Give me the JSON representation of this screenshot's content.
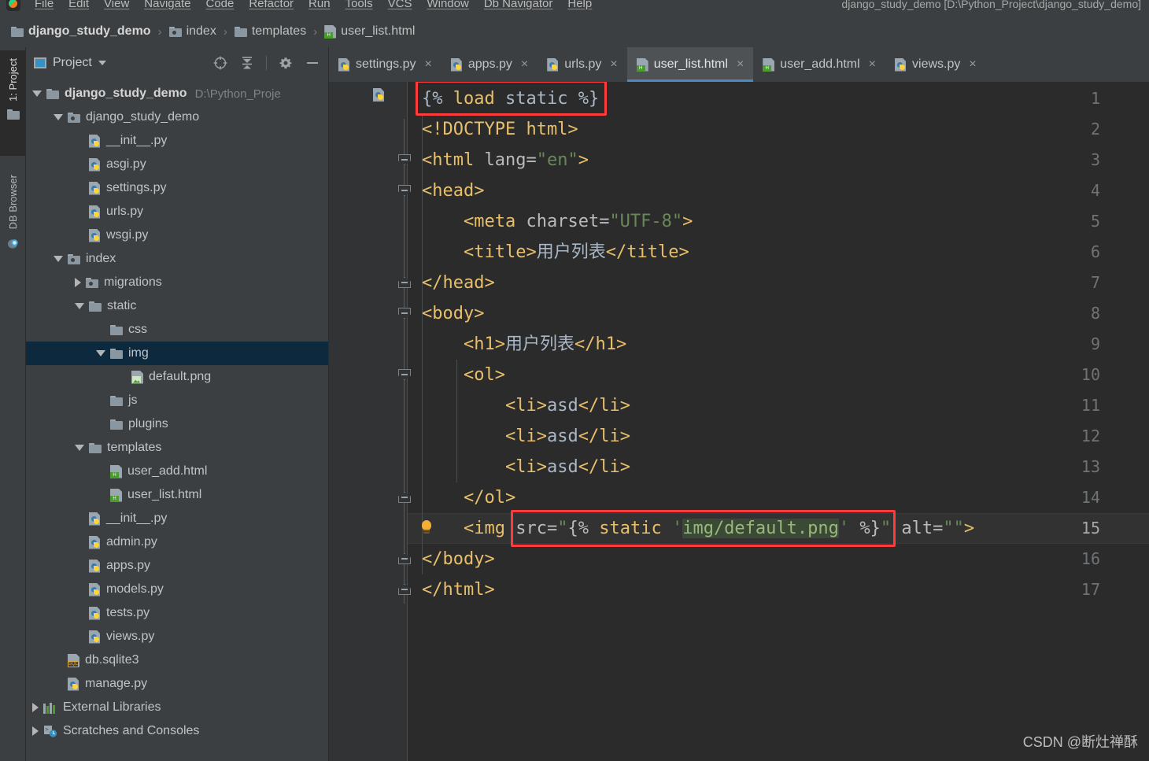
{
  "window": {
    "title": "django_study_demo [D:\\Python_Project\\django_study_demo]",
    "logo": "pycharm-logo-icon"
  },
  "menubar": {
    "items": [
      "File",
      "Edit",
      "View",
      "Navigate",
      "Code",
      "Refactor",
      "Run",
      "Tools",
      "VCS",
      "Window",
      "Db Navigator",
      "Help"
    ]
  },
  "breadcrumb": {
    "items": [
      {
        "label": "django_study_demo",
        "icon": "folder-icon",
        "bold": true
      },
      {
        "label": "index",
        "icon": "module-folder-icon",
        "bold": false
      },
      {
        "label": "templates",
        "icon": "folder-icon",
        "bold": false
      },
      {
        "label": "user_list.html",
        "icon": "html-file-icon",
        "bold": false
      }
    ],
    "separator": "›"
  },
  "toolstrip": {
    "buttons": [
      {
        "label": "1: Project",
        "icon": "project-folder-icon",
        "active": true
      },
      {
        "label": "DB Browser",
        "icon": "db-browser-icon",
        "active": false
      }
    ]
  },
  "project_panel": {
    "title": "Project",
    "caret": "chevron-down-icon",
    "tools": [
      "locate-target-icon",
      "collapse-all-icon",
      "settings-gear-icon",
      "hide-minus-icon"
    ],
    "tree": [
      {
        "depth": 0,
        "arrow": "down",
        "icon": "folder-icon",
        "name": "django_study_demo",
        "bold": true,
        "path": "D:\\Python_Proje",
        "selected": false
      },
      {
        "depth": 1,
        "arrow": "down",
        "icon": "module-folder-icon",
        "name": "django_study_demo",
        "bold": false,
        "path": "",
        "selected": false
      },
      {
        "depth": 2,
        "arrow": "none",
        "icon": "python-file-icon",
        "name": "__init__.py",
        "bold": false,
        "path": "",
        "selected": false
      },
      {
        "depth": 2,
        "arrow": "none",
        "icon": "python-file-icon",
        "name": "asgi.py",
        "bold": false,
        "path": "",
        "selected": false
      },
      {
        "depth": 2,
        "arrow": "none",
        "icon": "python-file-icon",
        "name": "settings.py",
        "bold": false,
        "path": "",
        "selected": false
      },
      {
        "depth": 2,
        "arrow": "none",
        "icon": "python-file-icon",
        "name": "urls.py",
        "bold": false,
        "path": "",
        "selected": false
      },
      {
        "depth": 2,
        "arrow": "none",
        "icon": "python-file-icon",
        "name": "wsgi.py",
        "bold": false,
        "path": "",
        "selected": false
      },
      {
        "depth": 1,
        "arrow": "down",
        "icon": "module-folder-icon",
        "name": "index",
        "bold": false,
        "path": "",
        "selected": false
      },
      {
        "depth": 2,
        "arrow": "right",
        "icon": "module-folder-icon",
        "name": "migrations",
        "bold": false,
        "path": "",
        "selected": false
      },
      {
        "depth": 2,
        "arrow": "down",
        "icon": "folder-icon",
        "name": "static",
        "bold": false,
        "path": "",
        "selected": false
      },
      {
        "depth": 3,
        "arrow": "none",
        "icon": "folder-icon",
        "name": "css",
        "bold": false,
        "path": "",
        "selected": false
      },
      {
        "depth": 3,
        "arrow": "down",
        "icon": "folder-icon",
        "name": "img",
        "bold": false,
        "path": "",
        "selected": true
      },
      {
        "depth": 4,
        "arrow": "none",
        "icon": "image-file-icon",
        "name": "default.png",
        "bold": false,
        "path": "",
        "selected": false
      },
      {
        "depth": 3,
        "arrow": "none",
        "icon": "folder-icon",
        "name": "js",
        "bold": false,
        "path": "",
        "selected": false
      },
      {
        "depth": 3,
        "arrow": "none",
        "icon": "folder-icon",
        "name": "plugins",
        "bold": false,
        "path": "",
        "selected": false
      },
      {
        "depth": 2,
        "arrow": "down",
        "icon": "folder-icon",
        "name": "templates",
        "bold": false,
        "path": "",
        "selected": false
      },
      {
        "depth": 3,
        "arrow": "none",
        "icon": "html-file-icon",
        "name": "user_add.html",
        "bold": false,
        "path": "",
        "selected": false
      },
      {
        "depth": 3,
        "arrow": "none",
        "icon": "html-file-icon",
        "name": "user_list.html",
        "bold": false,
        "path": "",
        "selected": false
      },
      {
        "depth": 2,
        "arrow": "none",
        "icon": "python-file-icon",
        "name": "__init__.py",
        "bold": false,
        "path": "",
        "selected": false
      },
      {
        "depth": 2,
        "arrow": "none",
        "icon": "python-file-icon",
        "name": "admin.py",
        "bold": false,
        "path": "",
        "selected": false
      },
      {
        "depth": 2,
        "arrow": "none",
        "icon": "python-file-icon",
        "name": "apps.py",
        "bold": false,
        "path": "",
        "selected": false
      },
      {
        "depth": 2,
        "arrow": "none",
        "icon": "python-file-icon",
        "name": "models.py",
        "bold": false,
        "path": "",
        "selected": false
      },
      {
        "depth": 2,
        "arrow": "none",
        "icon": "python-file-icon",
        "name": "tests.py",
        "bold": false,
        "path": "",
        "selected": false
      },
      {
        "depth": 2,
        "arrow": "none",
        "icon": "python-file-icon",
        "name": "views.py",
        "bold": false,
        "path": "",
        "selected": false
      },
      {
        "depth": 1,
        "arrow": "none",
        "icon": "sql-file-icon",
        "name": "db.sqlite3",
        "bold": false,
        "path": "",
        "selected": false
      },
      {
        "depth": 1,
        "arrow": "none",
        "icon": "python-file-icon",
        "name": "manage.py",
        "bold": false,
        "path": "",
        "selected": false
      },
      {
        "depth": 0,
        "arrow": "right",
        "icon": "external-libraries-icon",
        "name": "External Libraries",
        "bold": false,
        "path": "",
        "selected": false
      },
      {
        "depth": 0,
        "arrow": "right",
        "icon": "scratches-icon",
        "name": "Scratches and Consoles",
        "bold": false,
        "path": "",
        "selected": false
      }
    ]
  },
  "editor": {
    "tabs": [
      {
        "label": "settings.py",
        "icon": "python-file-icon",
        "active": false,
        "close": "×"
      },
      {
        "label": "apps.py",
        "icon": "python-file-icon",
        "active": false,
        "close": "×"
      },
      {
        "label": "urls.py",
        "icon": "python-file-icon",
        "active": false,
        "close": "×"
      },
      {
        "label": "user_list.html",
        "icon": "html-file-icon",
        "active": true,
        "close": "×"
      },
      {
        "label": "user_add.html",
        "icon": "html-file-icon",
        "active": false,
        "close": "×"
      },
      {
        "label": "views.py",
        "icon": "python-file-icon",
        "active": false,
        "close": "×"
      }
    ],
    "current_line": 15,
    "line_numbers": [
      1,
      2,
      3,
      4,
      5,
      6,
      7,
      8,
      9,
      10,
      11,
      12,
      13,
      14,
      15,
      16,
      17
    ],
    "code_lines": [
      {
        "n": 1,
        "text": "{% load static %}"
      },
      {
        "n": 2,
        "text": "<!DOCTYPE html>"
      },
      {
        "n": 3,
        "text": "<html lang=\"en\">"
      },
      {
        "n": 4,
        "text": "<head>"
      },
      {
        "n": 5,
        "text": "    <meta charset=\"UTF-8\">"
      },
      {
        "n": 6,
        "text": "    <title>用户列表</title>"
      },
      {
        "n": 7,
        "text": "</head>"
      },
      {
        "n": 8,
        "text": "<body>"
      },
      {
        "n": 9,
        "text": "    <h1>用户列表</h1>"
      },
      {
        "n": 10,
        "text": "    <ol>"
      },
      {
        "n": 11,
        "text": "        <li>asd</li>"
      },
      {
        "n": 12,
        "text": "        <li>asd</li>"
      },
      {
        "n": 13,
        "text": "        <li>asd</li>"
      },
      {
        "n": 14,
        "text": "    </ol>"
      },
      {
        "n": 15,
        "text": "    <img src=\"{% static 'img/default.png' %}\" alt=\"\">"
      },
      {
        "n": 16,
        "text": "</body>"
      },
      {
        "n": 17,
        "text": "</html>"
      }
    ],
    "gutter_icons": [
      {
        "line": 1,
        "icon": "django-template-file-icon"
      },
      {
        "line": 15,
        "icon": "intention-bulb-icon"
      }
    ],
    "annotations": [
      {
        "name": "load-static-highlight",
        "line": 1,
        "color": "#ff3b3b"
      },
      {
        "name": "static-src-highlight",
        "line": 15,
        "color": "#ff3b3b"
      }
    ]
  },
  "watermark": {
    "text": "CSDN @断灶禅酥"
  },
  "colors": {
    "editor_bg": "#2b2b2b",
    "panel_bg": "#3c3f41",
    "gutter_bg": "#313335",
    "selection": "#0d293e",
    "tab_active": "#4e5254",
    "tab_underline": "#4a88c7",
    "tag": "#e8bf6a",
    "attr": "#bababa",
    "value": "#6a8759",
    "text": "#a9b7c6",
    "annotation_red": "#ff3b3b"
  }
}
